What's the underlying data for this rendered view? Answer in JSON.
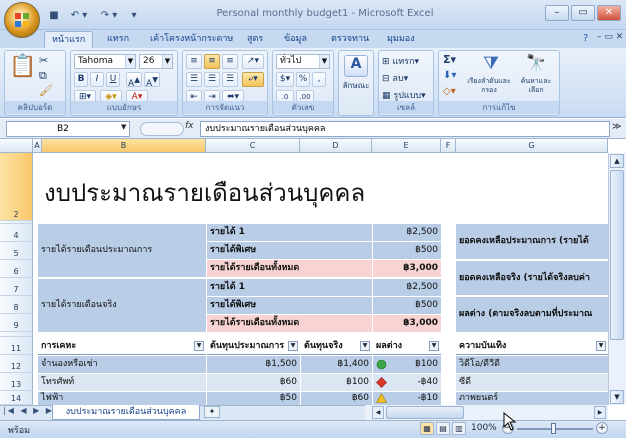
{
  "window": {
    "title": "Personal monthly budget1 - Microsoft Excel"
  },
  "qat": {
    "save_icon": "save-icon",
    "undo": "↶ ▾",
    "redo": "↷ ▾"
  },
  "tabs": [
    "หน้าแรก",
    "แทรก",
    "เค้าโครงหน้ากระดาษ",
    "สูตร",
    "ข้อมูล",
    "ตรวจทาน",
    "มุมมอง"
  ],
  "ribbon": {
    "clipboard": "คลิปบอร์ด",
    "font_group": "แบบอักษร",
    "font_name": "Tahoma",
    "font_size": "26",
    "alignment": "การจัดแนว",
    "number": "ตัวเลข",
    "number_format": "ทั่วไป",
    "styles": "ลักษณะ",
    "cells": "เซลล์",
    "insert": "แทรก",
    "delete": "ลบ",
    "format": "รูปแบบ",
    "editing": "การแก้ไข",
    "sort_filter": "เรียงลำดับและกรอง",
    "find_select": "ค้นหาและเลือก",
    "bold": "B",
    "italic": "I",
    "underline": "U",
    "percent": "%",
    "comma": ",",
    "sigma": "Σ"
  },
  "formula": {
    "name_box": "B2",
    "fx": "fx",
    "content": "งบประมาณรายเดือนส่วนบุคคล"
  },
  "columns": [
    "A",
    "B",
    "C",
    "D",
    "E",
    "F",
    "G"
  ],
  "rows": [
    "2",
    "3",
    "4",
    "5",
    "6",
    "7",
    "8",
    "9",
    "10",
    "11",
    "12",
    "13",
    "14"
  ],
  "sheet": {
    "title": "งบประมาณรายเดือนส่วนบุคคล",
    "projected_label": "รายได้รายเดือนประมาณการ",
    "actual_label": "รายได้รายเดือนจริง",
    "income1": "รายได้ 1",
    "extra": "รายได้พิเศษ",
    "total": "รายได้รายเดือนทั้งหมด",
    "proj_values": [
      "฿2,500",
      "฿500",
      "฿3,000"
    ],
    "act_values": [
      "฿2,500",
      "฿500",
      "฿3,000"
    ],
    "bal_proj": "ยอดคงเหลือประมาณการ (รายได้",
    "bal_act": "ยอดคงเหลือจริง (รายได้จริงลบค่า",
    "diff": "ผลต่าง (ตามจริงลบตามที่ประมาณ",
    "table_headers": [
      "การเคหะ",
      "ต้นทุนประมาณการ",
      "ต้นทุนจริง",
      "ผลต่าง"
    ],
    "table_rows": [
      {
        "name": "จำนองหรือเช่า",
        "projected": "฿1,500",
        "actual": "฿1,400",
        "diff": "฿100",
        "status_color": "#3aa845",
        "status_shape": "circle"
      },
      {
        "name": "โทรศัพท์",
        "projected": "฿60",
        "actual": "฿100",
        "diff": "-฿40",
        "status_color": "#d9372a",
        "status_shape": "diamond"
      },
      {
        "name": "ไฟฟ้า",
        "projected": "฿50",
        "actual": "฿60",
        "diff": "-฿10",
        "status_color": "#f0c020",
        "status_shape": "triangle"
      }
    ],
    "ent_header": "ความบันเทิง",
    "ent_items": [
      "วิดีโอ/ดีวีดี",
      "ซีดี",
      "ภาพยนตร์"
    ]
  },
  "sheet_tab": "งบประมาณรายเดือนส่วนบุคคล",
  "status": {
    "ready": "พร้อม",
    "zoom": "100%"
  }
}
